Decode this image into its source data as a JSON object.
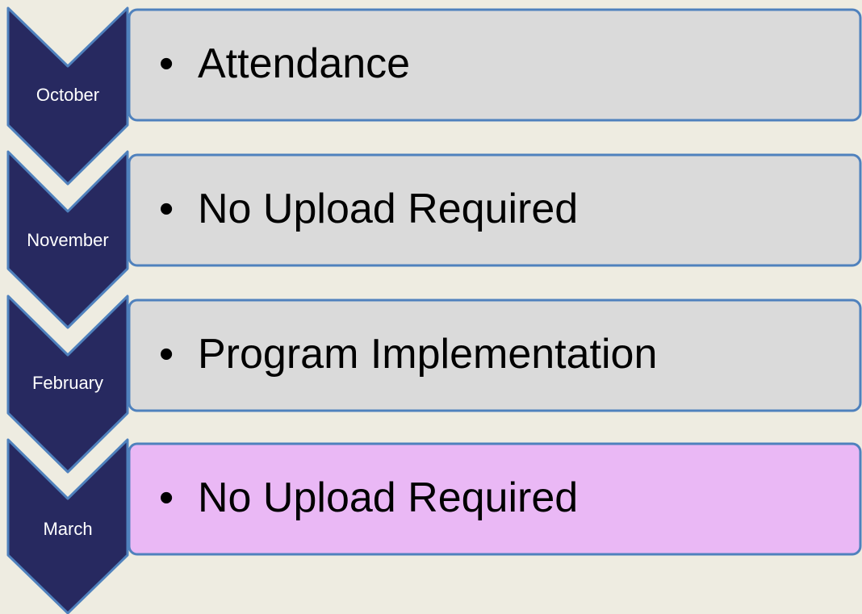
{
  "colors": {
    "background": "#EEECE1",
    "chevron_fill": "#272960",
    "chevron_stroke": "#4F81BD",
    "box_stroke": "#4F81BD",
    "box_default": "#DADADA",
    "box_highlight": "#EAB8F5"
  },
  "steps": [
    {
      "month": "October",
      "item": "Attendance",
      "box_fill": "#DADADA"
    },
    {
      "month": "November",
      "item": "No Upload Required",
      "box_fill": "#DADADA"
    },
    {
      "month": "February",
      "item": "Program Implementation",
      "box_fill": "#DADADA"
    },
    {
      "month": "March",
      "item": "No Upload Required",
      "box_fill": "#EAB8F5"
    }
  ]
}
